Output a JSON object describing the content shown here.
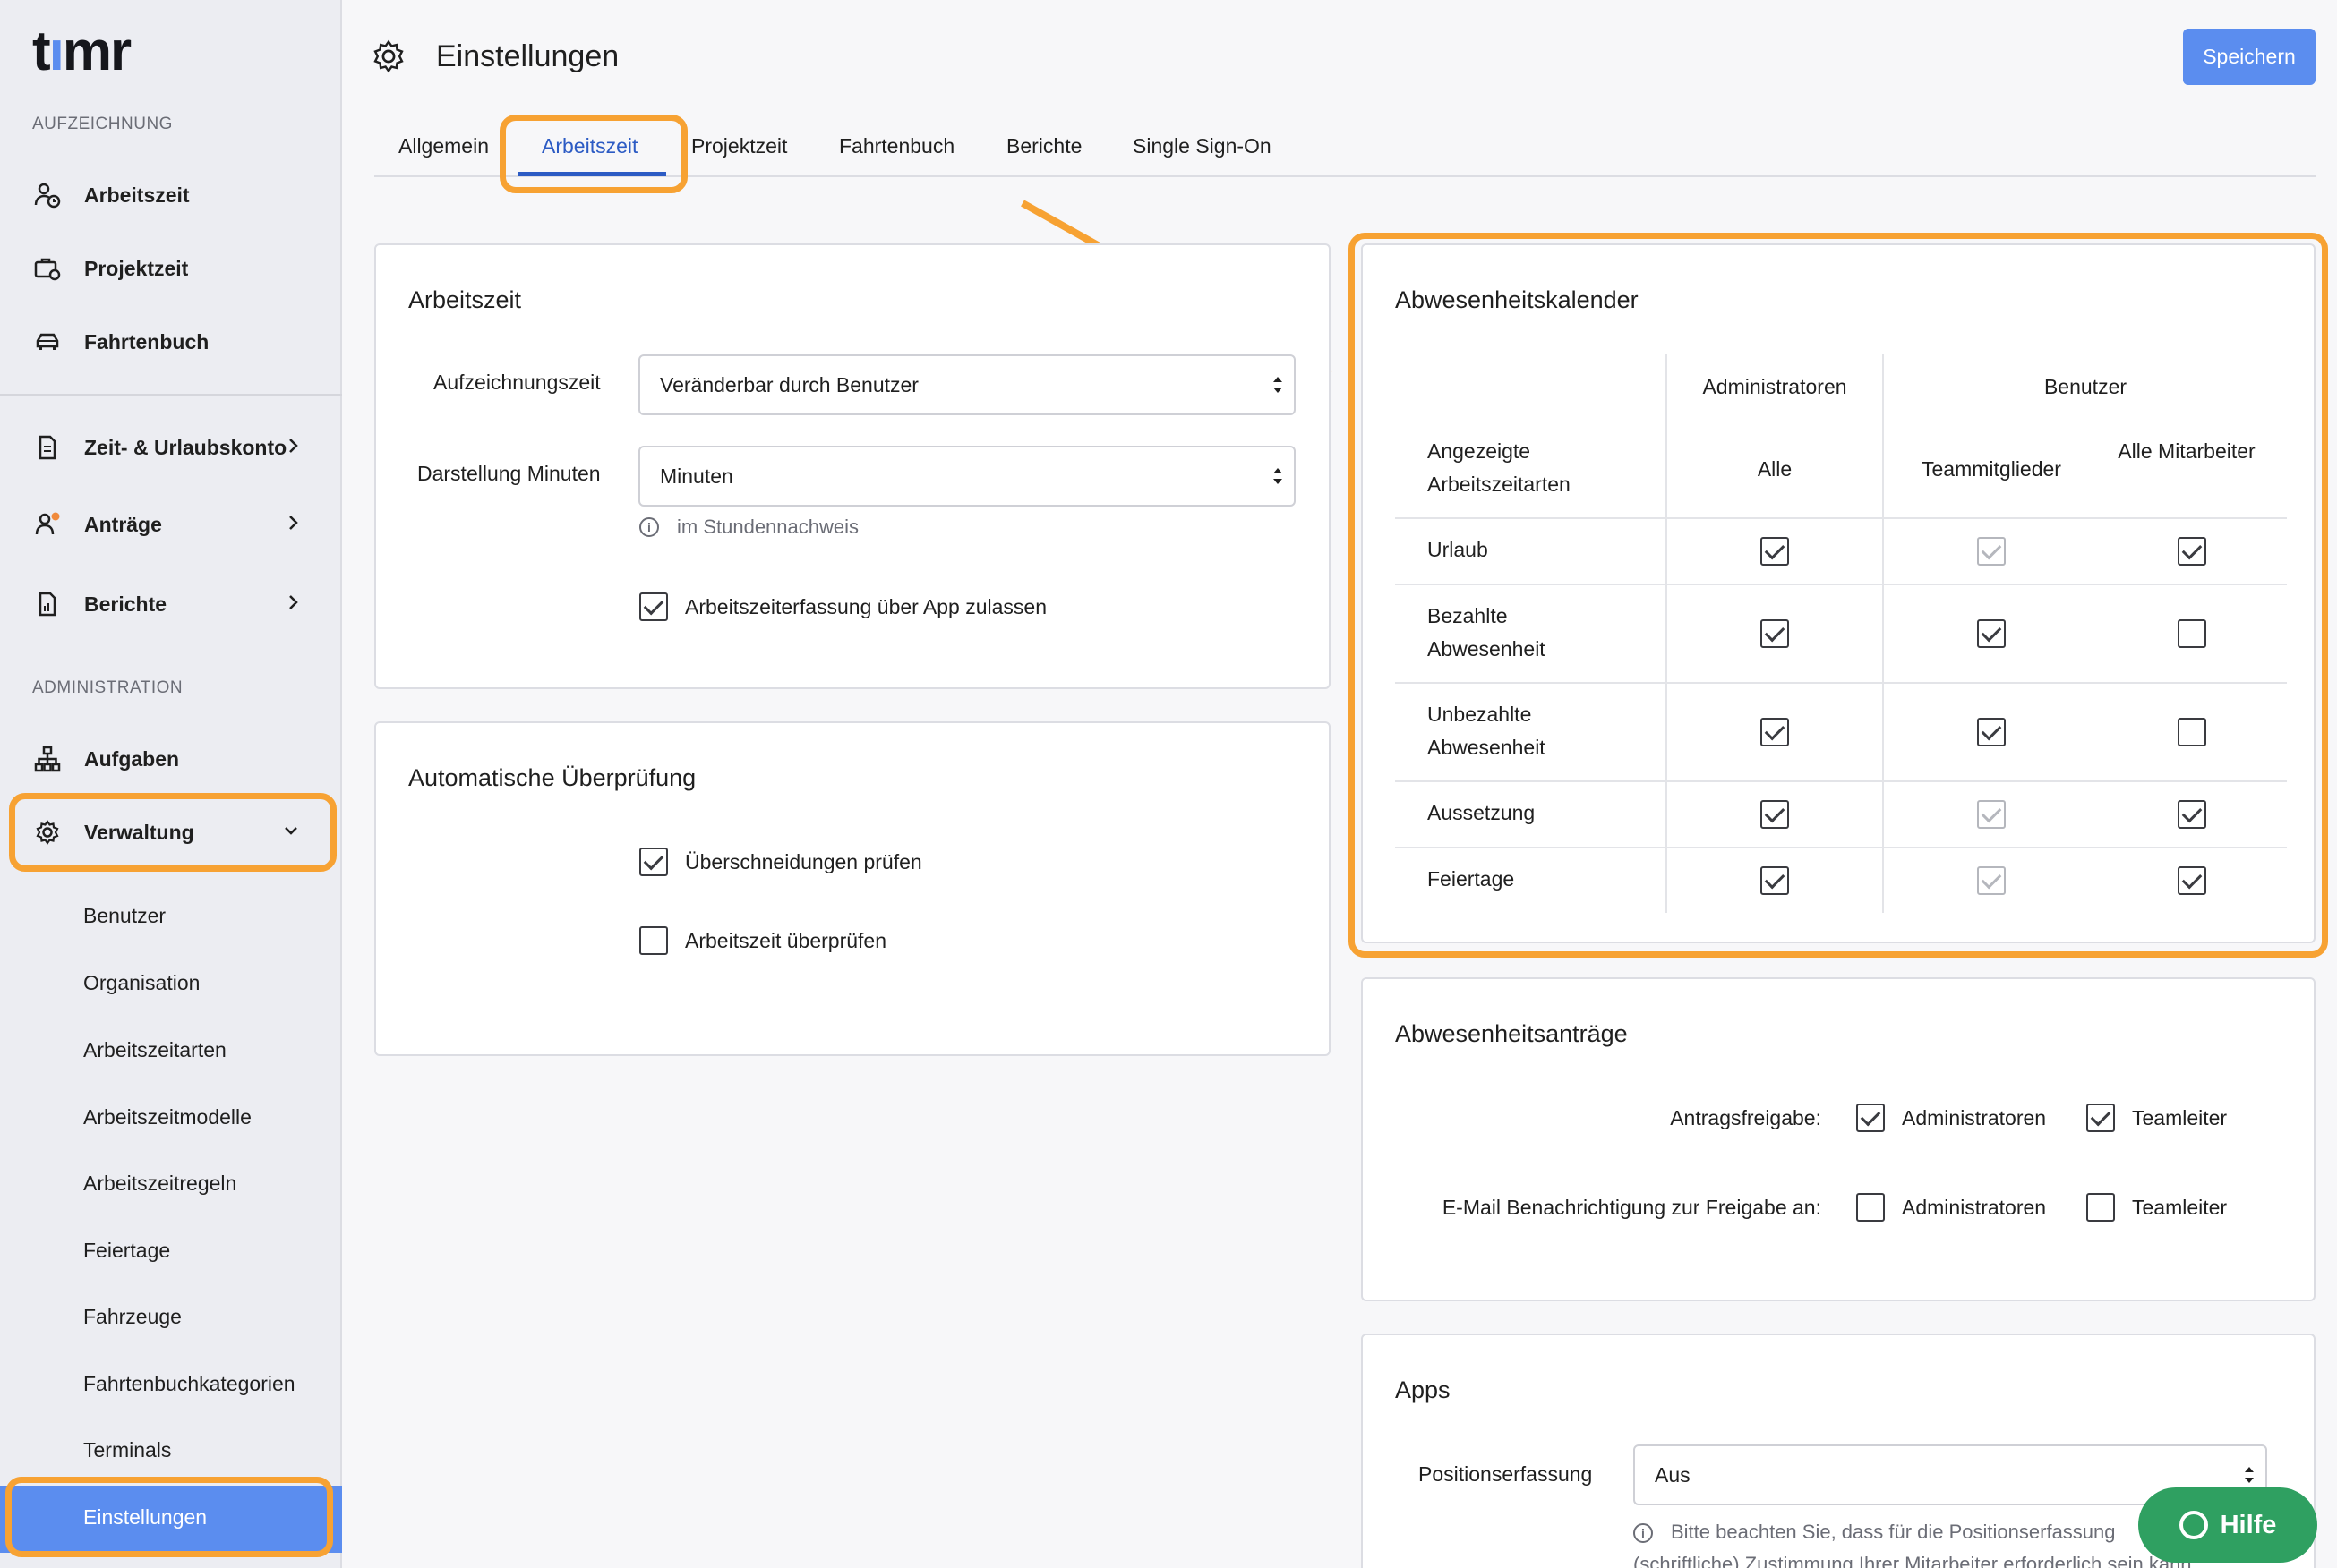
{
  "brand": {
    "logo": "timr",
    "accent": "#5b8def",
    "highlight": "#f7a233"
  },
  "sidebar": {
    "section_recording": "AUFZEICHNUNG",
    "section_admin": "ADMINISTRATION",
    "items": [
      {
        "label": "Arbeitszeit",
        "icon": "person-clock-icon"
      },
      {
        "label": "Projektzeit",
        "icon": "briefcase-icon"
      },
      {
        "label": "Fahrtenbuch",
        "icon": "car-icon"
      },
      {
        "label": "Zeit- & Urlaubskonto",
        "icon": "document-icon"
      },
      {
        "label": "Anträge",
        "icon": "person-notify-icon"
      },
      {
        "label": "Berichte",
        "icon": "report-icon"
      },
      {
        "label": "Aufgaben",
        "icon": "hierarchy-icon"
      },
      {
        "label": "Verwaltung",
        "icon": "gear-icon"
      }
    ],
    "sub_items": [
      "Benutzer",
      "Organisation",
      "Arbeitszeitarten",
      "Arbeitszeitmodelle",
      "Arbeitszeitregeln",
      "Feiertage",
      "Fahrzeuge",
      "Fahrtenbuchkategorien",
      "Terminals",
      "Einstellungen"
    ]
  },
  "header": {
    "title": "Einstellungen",
    "save_label": "Speichern"
  },
  "tabs": [
    "Allgemein",
    "Arbeitszeit",
    "Projektzeit",
    "Fahrtenbuch",
    "Berichte",
    "Single Sign-On"
  ],
  "active_tab": "Arbeitszeit",
  "arbeitszeit_card": {
    "title": "Arbeitszeit",
    "recording_label": "Aufzeichnungszeit",
    "recording_value": "Veränderbar durch Benutzer",
    "minutes_label": "Darstellung Minuten",
    "minutes_value": "Minuten",
    "minutes_hint": "im Stundennachweis",
    "app_checkbox_label": "Arbeitszeiterfassung über App zulassen",
    "app_checkbox_checked": true
  },
  "auto_check_card": {
    "title": "Automatische Überprüfung",
    "overlap_label": "Überschneidungen prüfen",
    "overlap_checked": true,
    "check_label": "Arbeitszeit überprüfen",
    "check_checked": false
  },
  "calendar_card": {
    "title": "Abwesenheitskalender",
    "group_admins": "Administratoren",
    "group_users": "Benutzer",
    "row_header": "Angezeigte Arbeitszeitarten",
    "col_all": "Alle",
    "col_team": "Teammitglieder",
    "col_all_staff": "Alle Mitarbeiter",
    "rows": [
      {
        "label": "Urlaub",
        "admins_all": true,
        "team": true,
        "team_disabled": true,
        "all_staff": true
      },
      {
        "label": "Bezahlte Abwesenheit",
        "admins_all": true,
        "team": true,
        "team_disabled": false,
        "all_staff": false
      },
      {
        "label": "Unbezahlte Abwesenheit",
        "admins_all": true,
        "team": true,
        "team_disabled": false,
        "all_staff": false
      },
      {
        "label": "Aussetzung",
        "admins_all": true,
        "team": true,
        "team_disabled": true,
        "all_staff": true
      },
      {
        "label": "Feiertage",
        "admins_all": true,
        "team": true,
        "team_disabled": true,
        "all_staff": true
      }
    ]
  },
  "requests_card": {
    "title": "Abwesenheitsanträge",
    "approval_label": "Antragsfreigabe:",
    "approval_admins": "Administratoren",
    "approval_admins_checked": true,
    "approval_leads": "Teamleiter",
    "approval_leads_checked": true,
    "email_label": "E-Mail Benachrichtigung zur Freigabe an:",
    "email_admins": "Administratoren",
    "email_admins_checked": false,
    "email_leads": "Teamleiter",
    "email_leads_checked": false
  },
  "apps_card": {
    "title": "Apps",
    "position_label": "Positionserfassung",
    "position_value": "Aus",
    "hint_line1": "Bitte beachten Sie, dass für die Positionserfassung",
    "hint_line2": "(schriftliche) Zustimmung Ihrer Mitarbeiter erforderlich sein kann."
  },
  "help": {
    "label": "Hilfe"
  }
}
